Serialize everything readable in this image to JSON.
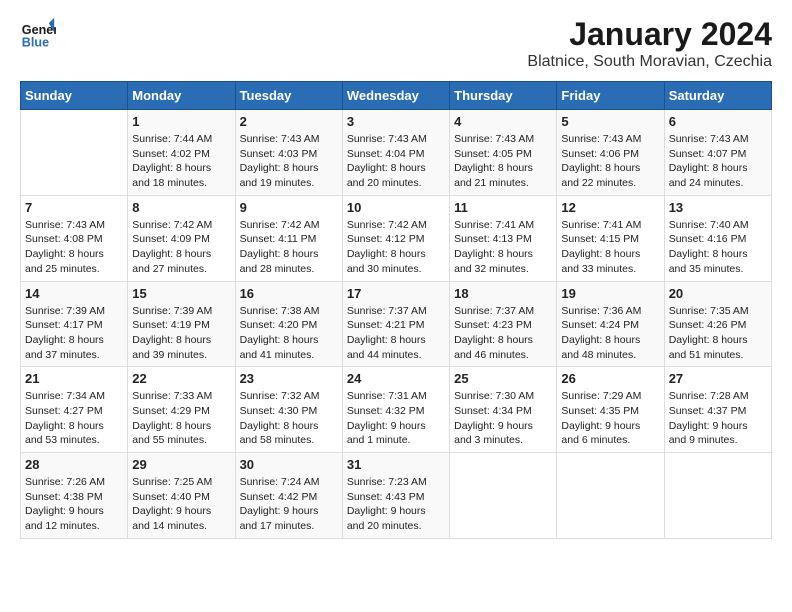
{
  "header": {
    "logo_line1": "General",
    "logo_line2": "Blue",
    "title": "January 2024",
    "subtitle": "Blatnice, South Moravian, Czechia"
  },
  "days_of_week": [
    "Sunday",
    "Monday",
    "Tuesday",
    "Wednesday",
    "Thursday",
    "Friday",
    "Saturday"
  ],
  "weeks": [
    [
      {
        "day": "",
        "info": ""
      },
      {
        "day": "1",
        "info": "Sunrise: 7:44 AM\nSunset: 4:02 PM\nDaylight: 8 hours\nand 18 minutes."
      },
      {
        "day": "2",
        "info": "Sunrise: 7:43 AM\nSunset: 4:03 PM\nDaylight: 8 hours\nand 19 minutes."
      },
      {
        "day": "3",
        "info": "Sunrise: 7:43 AM\nSunset: 4:04 PM\nDaylight: 8 hours\nand 20 minutes."
      },
      {
        "day": "4",
        "info": "Sunrise: 7:43 AM\nSunset: 4:05 PM\nDaylight: 8 hours\nand 21 minutes."
      },
      {
        "day": "5",
        "info": "Sunrise: 7:43 AM\nSunset: 4:06 PM\nDaylight: 8 hours\nand 22 minutes."
      },
      {
        "day": "6",
        "info": "Sunrise: 7:43 AM\nSunset: 4:07 PM\nDaylight: 8 hours\nand 24 minutes."
      }
    ],
    [
      {
        "day": "7",
        "info": "Sunrise: 7:43 AM\nSunset: 4:08 PM\nDaylight: 8 hours\nand 25 minutes."
      },
      {
        "day": "8",
        "info": "Sunrise: 7:42 AM\nSunset: 4:09 PM\nDaylight: 8 hours\nand 27 minutes."
      },
      {
        "day": "9",
        "info": "Sunrise: 7:42 AM\nSunset: 4:11 PM\nDaylight: 8 hours\nand 28 minutes."
      },
      {
        "day": "10",
        "info": "Sunrise: 7:42 AM\nSunset: 4:12 PM\nDaylight: 8 hours\nand 30 minutes."
      },
      {
        "day": "11",
        "info": "Sunrise: 7:41 AM\nSunset: 4:13 PM\nDaylight: 8 hours\nand 32 minutes."
      },
      {
        "day": "12",
        "info": "Sunrise: 7:41 AM\nSunset: 4:15 PM\nDaylight: 8 hours\nand 33 minutes."
      },
      {
        "day": "13",
        "info": "Sunrise: 7:40 AM\nSunset: 4:16 PM\nDaylight: 8 hours\nand 35 minutes."
      }
    ],
    [
      {
        "day": "14",
        "info": "Sunrise: 7:39 AM\nSunset: 4:17 PM\nDaylight: 8 hours\nand 37 minutes."
      },
      {
        "day": "15",
        "info": "Sunrise: 7:39 AM\nSunset: 4:19 PM\nDaylight: 8 hours\nand 39 minutes."
      },
      {
        "day": "16",
        "info": "Sunrise: 7:38 AM\nSunset: 4:20 PM\nDaylight: 8 hours\nand 41 minutes."
      },
      {
        "day": "17",
        "info": "Sunrise: 7:37 AM\nSunset: 4:21 PM\nDaylight: 8 hours\nand 44 minutes."
      },
      {
        "day": "18",
        "info": "Sunrise: 7:37 AM\nSunset: 4:23 PM\nDaylight: 8 hours\nand 46 minutes."
      },
      {
        "day": "19",
        "info": "Sunrise: 7:36 AM\nSunset: 4:24 PM\nDaylight: 8 hours\nand 48 minutes."
      },
      {
        "day": "20",
        "info": "Sunrise: 7:35 AM\nSunset: 4:26 PM\nDaylight: 8 hours\nand 51 minutes."
      }
    ],
    [
      {
        "day": "21",
        "info": "Sunrise: 7:34 AM\nSunset: 4:27 PM\nDaylight: 8 hours\nand 53 minutes."
      },
      {
        "day": "22",
        "info": "Sunrise: 7:33 AM\nSunset: 4:29 PM\nDaylight: 8 hours\nand 55 minutes."
      },
      {
        "day": "23",
        "info": "Sunrise: 7:32 AM\nSunset: 4:30 PM\nDaylight: 8 hours\nand 58 minutes."
      },
      {
        "day": "24",
        "info": "Sunrise: 7:31 AM\nSunset: 4:32 PM\nDaylight: 9 hours\nand 1 minute."
      },
      {
        "day": "25",
        "info": "Sunrise: 7:30 AM\nSunset: 4:34 PM\nDaylight: 9 hours\nand 3 minutes."
      },
      {
        "day": "26",
        "info": "Sunrise: 7:29 AM\nSunset: 4:35 PM\nDaylight: 9 hours\nand 6 minutes."
      },
      {
        "day": "27",
        "info": "Sunrise: 7:28 AM\nSunset: 4:37 PM\nDaylight: 9 hours\nand 9 minutes."
      }
    ],
    [
      {
        "day": "28",
        "info": "Sunrise: 7:26 AM\nSunset: 4:38 PM\nDaylight: 9 hours\nand 12 minutes."
      },
      {
        "day": "29",
        "info": "Sunrise: 7:25 AM\nSunset: 4:40 PM\nDaylight: 9 hours\nand 14 minutes."
      },
      {
        "day": "30",
        "info": "Sunrise: 7:24 AM\nSunset: 4:42 PM\nDaylight: 9 hours\nand 17 minutes."
      },
      {
        "day": "31",
        "info": "Sunrise: 7:23 AM\nSunset: 4:43 PM\nDaylight: 9 hours\nand 20 minutes."
      },
      {
        "day": "",
        "info": ""
      },
      {
        "day": "",
        "info": ""
      },
      {
        "day": "",
        "info": ""
      }
    ]
  ]
}
